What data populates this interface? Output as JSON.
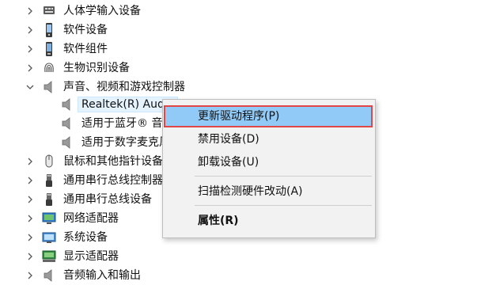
{
  "tree": {
    "items": [
      {
        "label": "人体学输入设备",
        "icon": "hid-icon",
        "expanded": false
      },
      {
        "label": "软件设备",
        "icon": "software-device-icon",
        "expanded": false
      },
      {
        "label": "软件组件",
        "icon": "software-component-icon",
        "expanded": false
      },
      {
        "label": "生物识别设备",
        "icon": "fingerprint-icon",
        "expanded": false
      },
      {
        "label": "声音、视频和游戏控制器",
        "icon": "speaker-icon",
        "expanded": true
      },
      {
        "label": "Realtek(R) Audio",
        "icon": "speaker-icon",
        "child": true,
        "selected": true
      },
      {
        "label": "适用于蓝牙® 音频的英特尔® 智音技术",
        "icon": "speaker-icon",
        "child": true
      },
      {
        "label": "适用于数字麦克风的英特尔® 智音技术",
        "icon": "speaker-icon",
        "child": true
      },
      {
        "label": "鼠标和其他指针设备",
        "icon": "mouse-icon",
        "expanded": false
      },
      {
        "label": "通用串行总线控制器",
        "icon": "usb-icon",
        "expanded": false
      },
      {
        "label": "通用串行总线设备",
        "icon": "usb-icon",
        "expanded": false
      },
      {
        "label": "网络适配器",
        "icon": "network-adapter-icon",
        "expanded": false
      },
      {
        "label": "系统设备",
        "icon": "system-device-icon",
        "expanded": false
      },
      {
        "label": "显示适配器",
        "icon": "display-adapter-icon",
        "expanded": false
      },
      {
        "label": "音频输入和输出",
        "icon": "audio-io-icon",
        "expanded": false
      }
    ]
  },
  "context_menu": {
    "update_driver": "更新驱动程序(P)",
    "disable_device": "禁用设备(D)",
    "uninstall_device": "卸载设备(U)",
    "scan_hardware": "扫描检测硬件改动(A)",
    "properties": "属性(R)"
  },
  "colors": {
    "menu_highlight": "#91c9f7",
    "highlight_border": "#e04848",
    "menu_background": "#f2f2f2"
  }
}
